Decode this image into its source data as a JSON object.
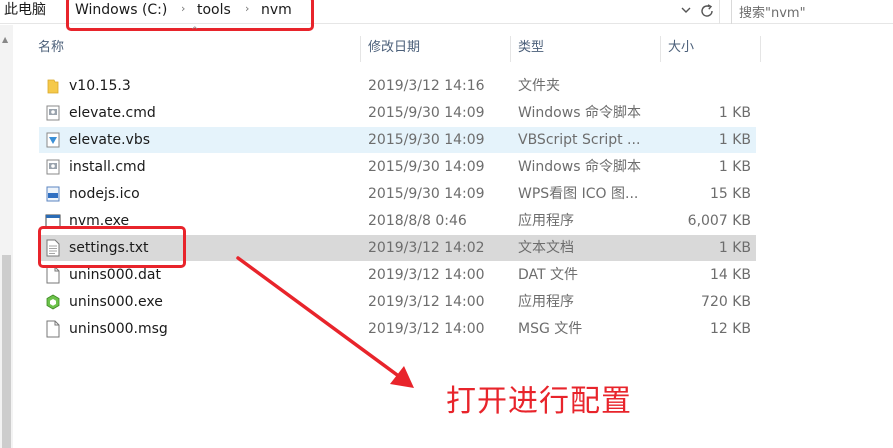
{
  "address": {
    "this_pc": "此电脑",
    "segments": [
      "Windows (C:)",
      "tools",
      "nvm"
    ],
    "separator": "›",
    "dropdown_icon": "chevron-down-icon",
    "refresh_icon": "refresh-icon"
  },
  "search": {
    "text": "搜索\"nvm\""
  },
  "columns": {
    "name": "名称",
    "date": "修改日期",
    "type": "类型",
    "size": "大小"
  },
  "files": [
    {
      "name": "v10.15.3",
      "date": "2019/3/12 14:16",
      "type": "文件夹",
      "size": "",
      "icon": "folder-icon"
    },
    {
      "name": "elevate.cmd",
      "date": "2015/9/30 14:09",
      "type": "Windows 命令脚本",
      "size": "1 KB",
      "icon": "cmd-file-icon"
    },
    {
      "name": "elevate.vbs",
      "date": "2015/9/30 14:09",
      "type": "VBScript Script ...",
      "size": "1 KB",
      "icon": "vbs-file-icon"
    },
    {
      "name": "install.cmd",
      "date": "2015/9/30 14:09",
      "type": "Windows 命令脚本",
      "size": "1 KB",
      "icon": "cmd-file-icon"
    },
    {
      "name": "nodejs.ico",
      "date": "2015/9/30 14:09",
      "type": "WPS看图 ICO 图...",
      "size": "15 KB",
      "icon": "ico-file-icon"
    },
    {
      "name": "nvm.exe",
      "date": "2018/8/8 0:46",
      "type": "应用程序",
      "size": "6,007 KB",
      "icon": "exe-file-icon"
    },
    {
      "name": "settings.txt",
      "date": "2019/3/12 14:02",
      "type": "文本文档",
      "size": "1 KB",
      "icon": "text-file-icon"
    },
    {
      "name": "unins000.dat",
      "date": "2019/3/12 14:00",
      "type": "DAT 文件",
      "size": "14 KB",
      "icon": "blank-file-icon"
    },
    {
      "name": "unins000.exe",
      "date": "2019/3/12 14:00",
      "type": "应用程序",
      "size": "720 KB",
      "icon": "node-exe-icon"
    },
    {
      "name": "unins000.msg",
      "date": "2019/3/12 14:00",
      "type": "MSG 文件",
      "size": "12 KB",
      "icon": "blank-file-icon"
    }
  ],
  "annotation": {
    "text": "打开进行配置"
  },
  "colors": {
    "annotation_red": "#e8242b",
    "selected_row": "#d9d9d9",
    "hover_row": "#e5f3fb",
    "header_text": "#4c607a"
  }
}
